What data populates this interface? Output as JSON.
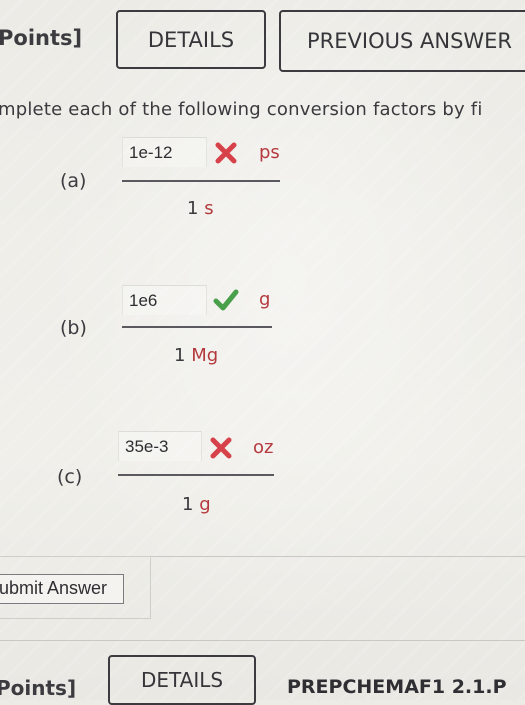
{
  "header": {
    "points_label": "Points]",
    "details_label": "DETAILS",
    "previous_answers_label": "PREVIOUS ANSWER"
  },
  "instructions": "mplete each of the following conversion factors by fi",
  "parts": [
    {
      "label": "(a)",
      "answer": "1e-12",
      "status": "incorrect",
      "unit": "ps",
      "denominator_value": "1",
      "denominator_unit": "s"
    },
    {
      "label": "(b)",
      "answer": "1e6",
      "status": "correct",
      "unit": "g",
      "denominator_value": "1",
      "denominator_unit": "Mg"
    },
    {
      "label": "(c)",
      "answer": "35e-3",
      "status": "incorrect",
      "unit": "oz",
      "denominator_value": "1",
      "denominator_unit": "g"
    }
  ],
  "submit_label": "ubmit Answer",
  "footer": {
    "points_label": "Points]",
    "details_label": "DETAILS",
    "assignment_code": "PREPCHEMAF1 2.1.P"
  },
  "colors": {
    "incorrect": "#d6414a",
    "correct": "#4aa04a",
    "unit": "#b53a3f",
    "background": "#efeee9"
  },
  "icons": {
    "incorrect": "close-x-icon",
    "correct": "check-icon"
  }
}
